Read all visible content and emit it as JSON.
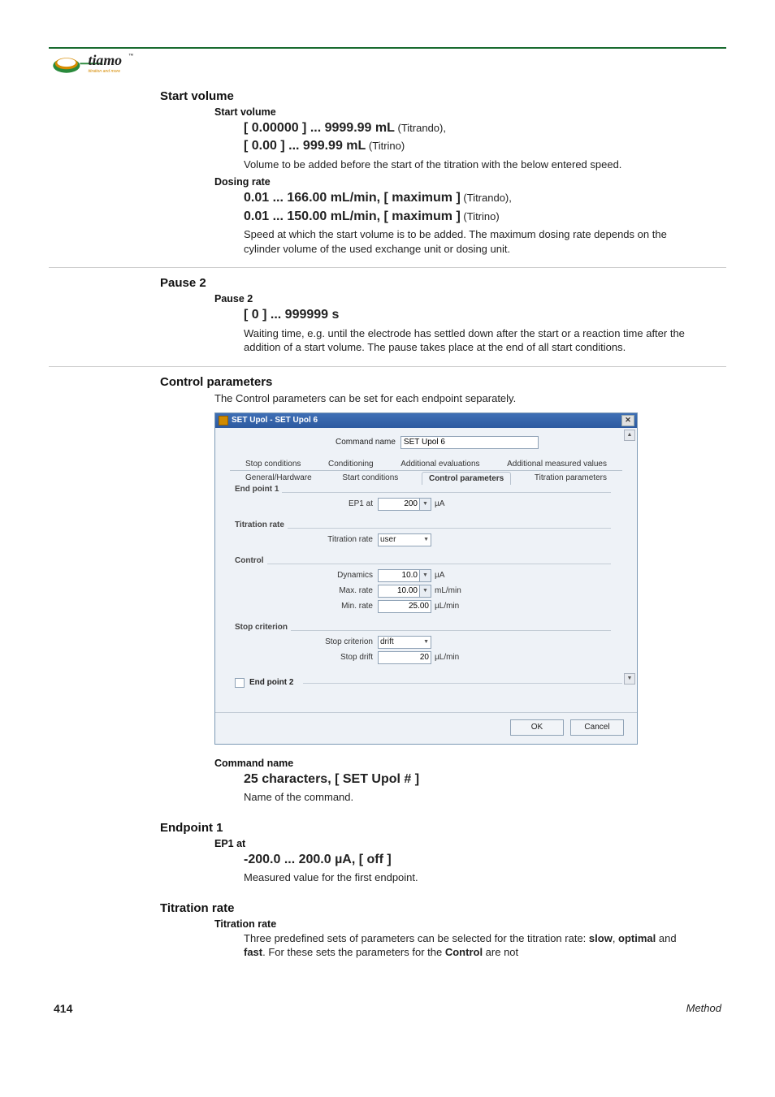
{
  "logo": {
    "brand": "tiamo",
    "tagline": "titration and more",
    "tm": "™"
  },
  "sections": {
    "start_volume": {
      "title": "Start volume",
      "sv": {
        "label": "Start volume",
        "range1": "[ 0.00000 ] ... 9999.99 mL",
        "range1_note": " (Titrando),",
        "range2": "[ 0.00 ] ... 999.99 mL",
        "range2_note": " (Titrino)",
        "desc": "Volume to be added before the start of the titration with the below entered speed."
      },
      "dr": {
        "label": "Dosing rate",
        "range1": "0.01 ... 166.00 mL/min, [ maximum ]",
        "range1_note": " (Titrando),",
        "range2": "0.01 ... 150.00 mL/min, [ maximum ]",
        "range2_note": " (Titrino)",
        "desc": "Speed at which the start volume is to be added. The maximum dosing rate depends on the cylinder volume of the used exchange unit or dosing unit."
      }
    },
    "pause2": {
      "title": "Pause 2",
      "p2": {
        "label": "Pause 2",
        "range": "[ 0 ] ... 999999 s",
        "desc": "Waiting time, e.g. until the electrode has settled down after the start or a re­action time after the addition of a start volume. The pause takes place at the end of all start conditions."
      }
    },
    "control_params": {
      "title": "Control parameters",
      "intro": "The Control parameters can be set for each endpoint separately.",
      "cmd_name": {
        "label": "Command name",
        "range": "25 characters, [ SET Upol # ]",
        "desc": "Name of the command."
      }
    },
    "endpoint1": {
      "title": "Endpoint 1",
      "ep1": {
        "label": "EP1 at",
        "range": "-200.0 ... 200.0 µA, [ off ]",
        "desc": "Measured value for the first endpoint."
      }
    },
    "titration_rate": {
      "title": "Titration rate",
      "tr": {
        "label": "Titration rate",
        "desc_pre": "Three predefined sets of parameters can be selected for the titration rate: ",
        "slow": "slow",
        "sep1": ", ",
        "optimal": "optimal",
        "sep2": " and ",
        "fast": "fast",
        "desc_post": ". For these sets the parameters for the ",
        "control_bold": "Control",
        "desc_end": " are not"
      }
    }
  },
  "dialog": {
    "title": "SET Upol - SET Upol 6",
    "cmd_label": "Command name",
    "cmd_value": "SET Upol 6",
    "tabs_top": [
      "Stop conditions",
      "Conditioning",
      "Additional evaluations",
      "Additional measured values"
    ],
    "tabs_bottom": [
      "General/Hardware",
      "Start conditions",
      "Control parameters",
      "Titration parameters"
    ],
    "active_tab": "Control parameters",
    "grp_ep1": {
      "title": "End point 1",
      "ep1_label": "EP1 at",
      "ep1_value": "200",
      "ep1_unit": "µA"
    },
    "grp_tr": {
      "title": "Titration rate",
      "tr_label": "Titration rate",
      "tr_value": "user"
    },
    "grp_ctrl": {
      "title": "Control",
      "dyn_label": "Dynamics",
      "dyn_value": "10.0",
      "dyn_unit": "µA",
      "max_label": "Max. rate",
      "max_value": "10.00",
      "max_unit": "mL/min",
      "min_label": "Min. rate",
      "min_value": "25.00",
      "min_unit": "µL/min"
    },
    "grp_stop": {
      "title": "Stop criterion",
      "sc_label": "Stop criterion",
      "sc_value": "drift",
      "sd_label": "Stop drift",
      "sd_value": "20",
      "sd_unit": "µL/min"
    },
    "ep2_label": "End point 2",
    "ok": "OK",
    "cancel": "Cancel"
  },
  "footer": {
    "page": "414",
    "method": "Method"
  }
}
